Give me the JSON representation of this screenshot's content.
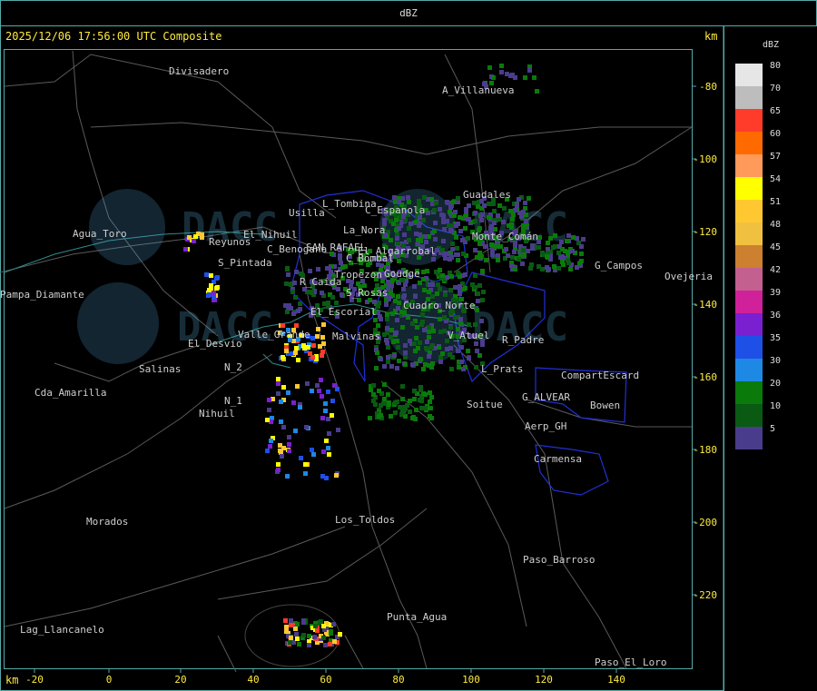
{
  "header": {
    "title": "dBZ"
  },
  "status": {
    "timestamp": "2025/12/06 17:56:00 UTC Composite",
    "unit_top": "km",
    "unit_bottom": "km"
  },
  "legend": {
    "title": "dBZ",
    "levels": [
      {
        "label": "80",
        "color": "#e6e6e6"
      },
      {
        "label": "70",
        "color": "#bdbdbd"
      },
      {
        "label": "65",
        "color": "#ff3b2a"
      },
      {
        "label": "60",
        "color": "#ff6a00"
      },
      {
        "label": "57",
        "color": "#ff9a5a"
      },
      {
        "label": "54",
        "color": "#ffff00"
      },
      {
        "label": "51",
        "color": "#ffc830"
      },
      {
        "label": "48",
        "color": "#f0c040"
      },
      {
        "label": "45",
        "color": "#cc8030"
      },
      {
        "label": "42",
        "color": "#c46090"
      },
      {
        "label": "39",
        "color": "#d0209a"
      },
      {
        "label": "36",
        "color": "#7a20d0"
      },
      {
        "label": "35",
        "color": "#1e50e8"
      },
      {
        "label": "30",
        "color": "#1e88e5"
      },
      {
        "label": "20",
        "color": "#0a7a0a"
      },
      {
        "label": "10",
        "color": "#0a5a14"
      },
      {
        "label": "5",
        "color": "#4a3c8c"
      }
    ]
  },
  "axes": {
    "x_ticks": [
      "-20",
      "0",
      "20",
      "40",
      "60",
      "80",
      "100",
      "120",
      "140"
    ],
    "y_ticks": [
      "-80",
      "-100",
      "-120",
      "-140",
      "-160",
      "-180",
      "-200",
      "-220"
    ]
  },
  "places": [
    "Divisadero",
    "A_Villanueva",
    "Guadales",
    "Agua_Toro",
    "Reyunos",
    "El_Nihuil",
    "S_Pintada",
    "Usilla",
    "L_Tombina",
    "C_Espanola",
    "La_Nora",
    "C_Benogana",
    "SAN_RAFAEL",
    "El_Algarrobal",
    "C_Bombal",
    "G_Campos",
    "Ovejeria",
    "Tropezon",
    "Goudge",
    "R_Caida",
    "S_Rosas",
    "Monte_Comán",
    "Cuadro_Norte",
    "El_Escorial",
    "Valle_Grande",
    "El_Desvio",
    "Malvinas",
    "V_Atuel",
    "R_Padre",
    "Salinas",
    "L_Prats",
    "CompartEscard",
    "Cda_Amarilla",
    "G_ALVEAR",
    "Soitue",
    "Bowen",
    "Aerp_GH",
    "Carmensa",
    "N_2",
    "N_1",
    "Nihuil",
    "Morados",
    "Los_Toldos",
    "Paso_Barroso",
    "Punta_Agua",
    "Lag_Llancanelo",
    "Paso_El_Loro",
    "Pampa_Diamante"
  ]
}
